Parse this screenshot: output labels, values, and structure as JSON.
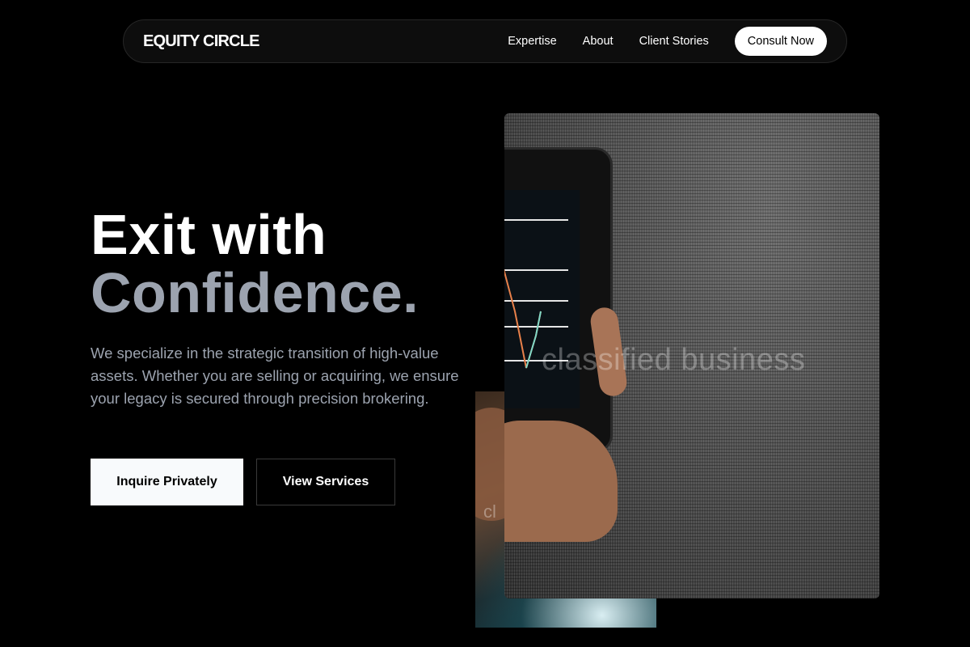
{
  "nav": {
    "brand": "EQUITY CIRCLE",
    "links": [
      {
        "label": "Expertise"
      },
      {
        "label": "About"
      },
      {
        "label": "Client Stories"
      }
    ],
    "cta_label": "Consult Now"
  },
  "hero": {
    "headline_line1": "Exit with",
    "headline_line2": "Confidence.",
    "lede": "We specialize in the strategic transition of high-value assets. Whether you are selling or acquiring, we ensure your legacy is secured through precision brokering.",
    "primary_button": "Inquire Privately",
    "secondary_button": "View Services"
  },
  "images": {
    "front_watermark": "classified business",
    "back_watermark": "cl"
  },
  "colors": {
    "background": "#000000",
    "headline_muted": "#9ca3af",
    "button_primary_bg": "#f8fafc"
  }
}
